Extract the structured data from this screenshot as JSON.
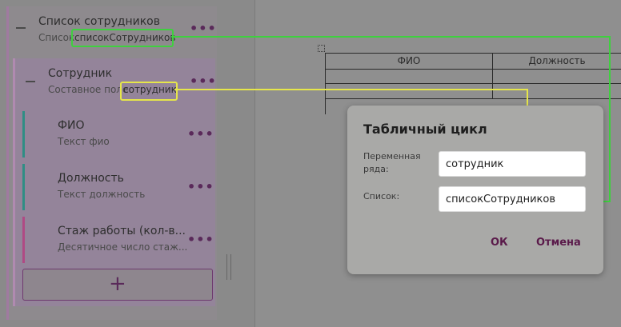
{
  "list": {
    "title": "Список сотрудников",
    "subtitle_prefix": "Список",
    "subtitle_var": "списокСотрудников"
  },
  "employee": {
    "title": "Сотрудник",
    "subtitle_prefix": "Составное поле",
    "subtitle_var": "сотрудник"
  },
  "fields": [
    {
      "title": "ФИО",
      "subtitle": "Текст фио",
      "color": "#2f8e85"
    },
    {
      "title": "Должность",
      "subtitle": "Текст должность",
      "color": "#2f8e85"
    },
    {
      "title": "Стаж работы (кол-в...",
      "subtitle": "Десятичное число стаж...",
      "color": "#b04a84"
    }
  ],
  "add_symbol": "+",
  "more_symbol": "•••",
  "table": {
    "headers": [
      "ФИО",
      "Должность"
    ]
  },
  "dialog": {
    "title": "Табличный цикл",
    "row_var_label": "Переменная ряда:",
    "row_var_value": "сотрудник",
    "list_label": "Список:",
    "list_value": "списокСотрудников",
    "ok_label": "ОК",
    "cancel_label": "Отмена"
  },
  "colors": {
    "highlight_green": "#3fd03f",
    "highlight_yellow": "#e6e64a"
  }
}
